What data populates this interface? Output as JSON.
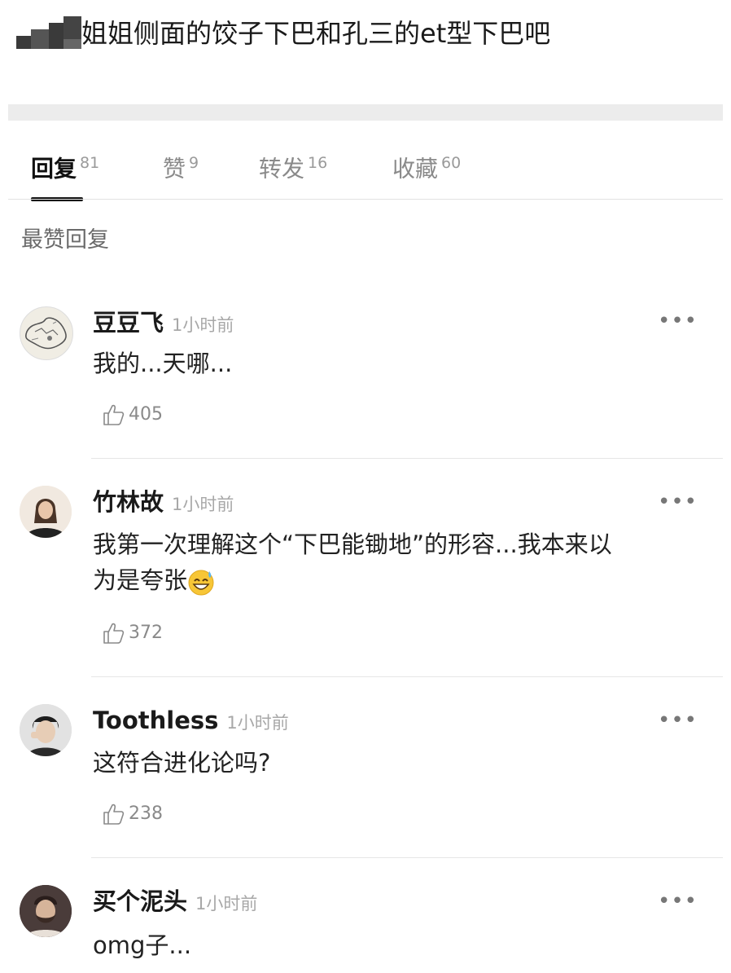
{
  "post": {
    "title": "姐姐侧面的饺子下巴和孔三的et型下巴吧"
  },
  "tabs": [
    {
      "label": "回复",
      "count": "81",
      "active": true
    },
    {
      "label": "赞",
      "count": "9"
    },
    {
      "label": "转发",
      "count": "16"
    },
    {
      "label": "收藏",
      "count": "60"
    }
  ],
  "section": {
    "title": "最赞回复"
  },
  "comments": [
    {
      "user": "豆豆飞",
      "time": "1小时前",
      "text": "我的...天哪...",
      "likes": "405",
      "avatar_icon": "sketch-map-avatar"
    },
    {
      "user": "竹林故",
      "time": "1小时前",
      "text_line1": "我第一次理解这个“下巴能锄地”的形容...我本来以",
      "text_line2": "为是夸张",
      "emoji": "grinning-sweat-emoji",
      "likes": "372",
      "avatar_icon": "woman-portrait-avatar"
    },
    {
      "user": "Toothless",
      "time": "1小时前",
      "text": "这符合进化论吗?",
      "likes": "238",
      "avatar_icon": "man-portrait-avatar"
    },
    {
      "user": "买个泥头",
      "time": "1小时前",
      "text": "omg子...",
      "avatar_icon": "bearded-man-avatar"
    }
  ],
  "icons": {
    "more": "more-options-icon",
    "like": "thumbs-up-icon"
  }
}
